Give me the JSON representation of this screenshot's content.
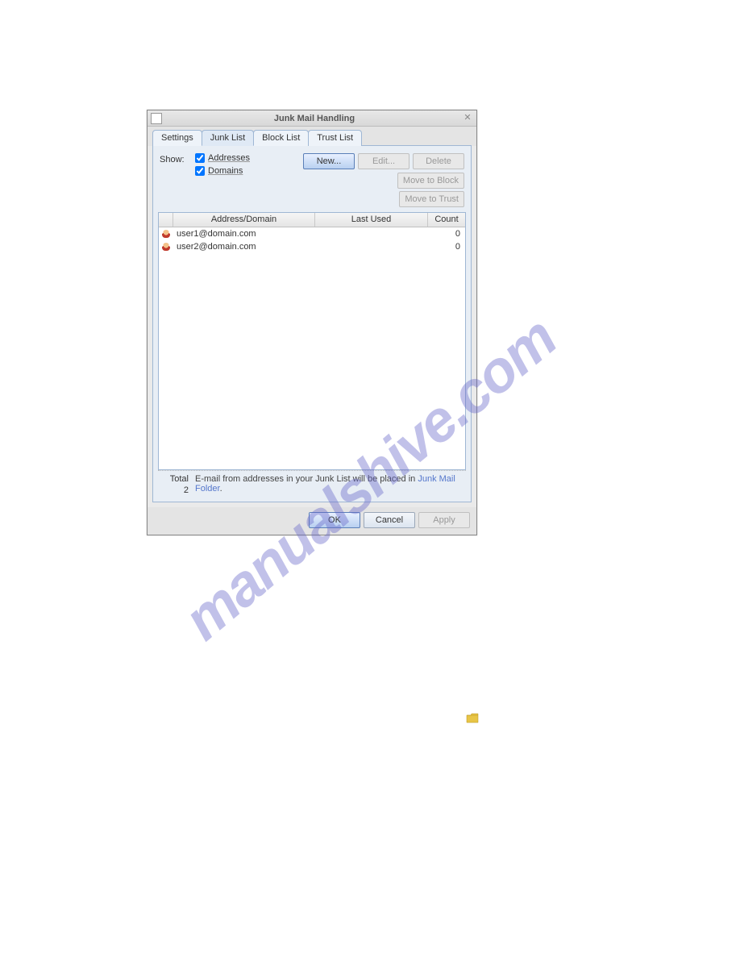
{
  "dialog": {
    "title": "Junk Mail Handling",
    "tabs": [
      {
        "label": "Settings",
        "active": false
      },
      {
        "label": "Junk List",
        "active": true
      },
      {
        "label": "Block List",
        "active": false
      },
      {
        "label": "Trust List",
        "active": false
      }
    ],
    "show_label": "Show:",
    "checkboxes": {
      "addresses": {
        "label": "Addresses",
        "checked": true
      },
      "domains": {
        "label": "Domains",
        "checked": true
      }
    },
    "buttons": {
      "new": "New...",
      "edit": "Edit...",
      "delete": "Delete",
      "move_block": "Move to Block",
      "move_trust": "Move to Trust"
    },
    "columns": {
      "address": "Address/Domain",
      "last_used": "Last Used",
      "count": "Count"
    },
    "rows": [
      {
        "address": "user1@domain.com",
        "last_used": "",
        "count": "0"
      },
      {
        "address": "user2@domain.com",
        "last_used": "",
        "count": "0"
      }
    ],
    "total_label": "Total",
    "total_value": "2",
    "note_text": "E-mail from addresses in your Junk List will be placed in ",
    "note_link": "Junk Mail Folder",
    "note_suffix": ".",
    "footer": {
      "ok": "OK",
      "cancel": "Cancel",
      "apply": "Apply"
    }
  },
  "watermark": "manualshive.com"
}
